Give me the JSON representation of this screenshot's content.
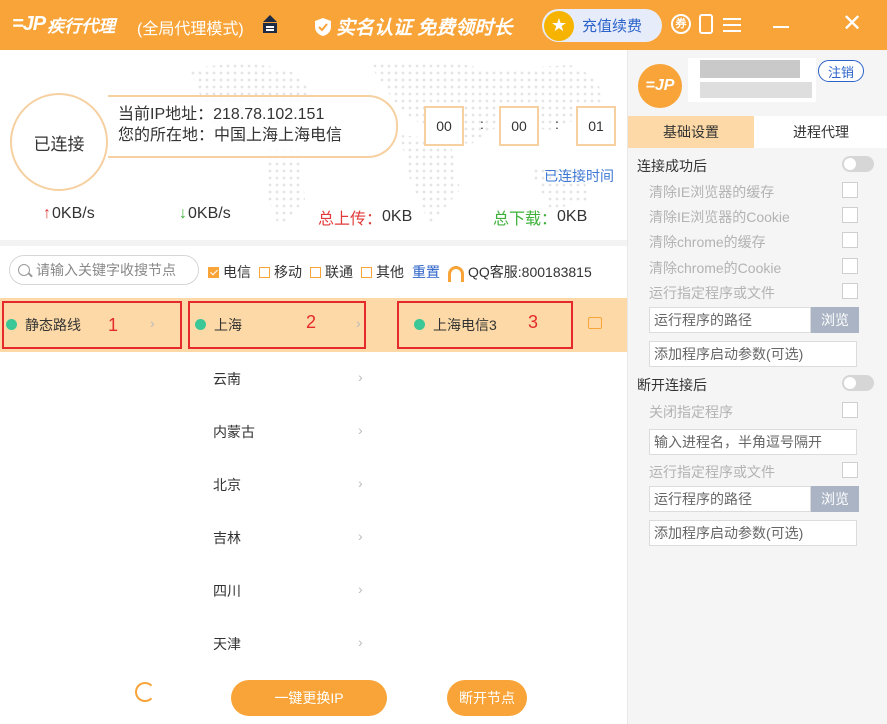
{
  "title_bar": {
    "logo_mark": "=JP",
    "app_name": "疾行代理",
    "mode": "(全局代理模式)",
    "promo": "实名认证 免费领时长",
    "recharge_label": "充值续费",
    "coin_glyph": "券",
    "close_glyph": "✕"
  },
  "connection": {
    "status": "已连接",
    "ip_line": "当前IP地址：218.78.102.151",
    "location_line": "您的所在地：中国上海上海电信",
    "timer": [
      "00",
      "00",
      "01"
    ],
    "timer_sep": ":",
    "time_label": "已连接时间",
    "upload_speed": "0KB/s",
    "download_speed": "0KB/s",
    "total_upload_label": "总上传：",
    "total_upload_value": "0KB",
    "total_download_label": "总下载：",
    "total_download_value": "0KB"
  },
  "filter": {
    "search_placeholder": "请输入关键字收搜节点",
    "options": [
      {
        "label": "电信",
        "checked": true
      },
      {
        "label": "移动",
        "checked": false
      },
      {
        "label": "联通",
        "checked": false
      },
      {
        "label": "其他",
        "checked": false
      }
    ],
    "reset_label": "重置",
    "qq_service": "QQ客服:800183815"
  },
  "node_list": {
    "column1": [
      {
        "label": "静态路线",
        "annotation": "1"
      }
    ],
    "column2": [
      "上海",
      "云南",
      "内蒙古",
      "北京",
      "吉林",
      "四川",
      "天津"
    ],
    "column2_annotation": "2",
    "column3": [
      {
        "label": "上海电信3",
        "annotation": "3"
      }
    ]
  },
  "actions": {
    "change_ip": "一键更换IP",
    "disconnect": "断开节点"
  },
  "right_panel": {
    "logout": "注销",
    "tabs": [
      "基础设置",
      "进程代理"
    ],
    "on_connect": {
      "title": "连接成功后",
      "options": [
        "清除IE浏览器的缓存",
        "清除IE浏览器的Cookie",
        "清除chrome的缓存",
        "清除chrome的Cookie",
        "运行指定程序或文件"
      ],
      "program_path": "运行程序的路径",
      "browse": "浏览",
      "launch_args": "添加程序启动参数(可选)"
    },
    "on_disconnect": {
      "title": "断开连接后",
      "close_program": "关闭指定程序",
      "process_input": "输入进程名，半角逗号隔开",
      "run_program": "运行指定程序或文件",
      "program_path": "运行程序的路径",
      "browse": "浏览",
      "launch_args": "添加程序启动参数(可选)"
    }
  },
  "colors": {
    "brand_orange": "#f8a438",
    "selected_row": "#fcd9a6",
    "link_blue": "#2c63c9",
    "annotation_red": "#e42a2a",
    "status_green": "#3cc796"
  }
}
